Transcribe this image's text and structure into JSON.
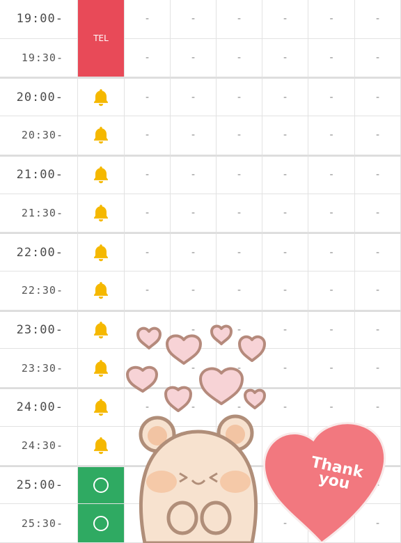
{
  "schedule": {
    "rows": [
      {
        "time": "19:00-",
        "status": "tel",
        "status_label": "TEL",
        "other_cells": [
          "-",
          "-",
          "-",
          "-",
          "-",
          "-"
        ]
      },
      {
        "time": "19:30-",
        "status": "tel",
        "status_label": "",
        "other_cells": [
          "-",
          "-",
          "-",
          "-",
          "-",
          "-"
        ]
      },
      {
        "time": "20:00-",
        "status": "bell",
        "status_label": "",
        "other_cells": [
          "-",
          "-",
          "-",
          "-",
          "-",
          "-"
        ]
      },
      {
        "time": "20:30-",
        "status": "bell",
        "status_label": "",
        "other_cells": [
          "-",
          "-",
          "-",
          "-",
          "-",
          "-"
        ]
      },
      {
        "time": "21:00-",
        "status": "bell",
        "status_label": "",
        "other_cells": [
          "-",
          "-",
          "-",
          "-",
          "-",
          "-"
        ]
      },
      {
        "time": "21:30-",
        "status": "bell",
        "status_label": "",
        "other_cells": [
          "-",
          "-",
          "-",
          "-",
          "-",
          "-"
        ]
      },
      {
        "time": "22:00-",
        "status": "bell",
        "status_label": "",
        "other_cells": [
          "-",
          "-",
          "-",
          "-",
          "-",
          "-"
        ]
      },
      {
        "time": "22:30-",
        "status": "bell",
        "status_label": "",
        "other_cells": [
          "-",
          "-",
          "-",
          "-",
          "-",
          "-"
        ]
      },
      {
        "time": "23:00-",
        "status": "bell",
        "status_label": "",
        "other_cells": [
          "-",
          "-",
          "-",
          "-",
          "-",
          "-"
        ]
      },
      {
        "time": "23:30-",
        "status": "bell",
        "status_label": "",
        "other_cells": [
          "-",
          "-",
          "-",
          "-",
          "-",
          "-"
        ]
      },
      {
        "time": "24:00-",
        "status": "bell",
        "status_label": "",
        "other_cells": [
          "-",
          "-",
          "-",
          "-",
          "-",
          "-"
        ]
      },
      {
        "time": "24:30-",
        "status": "bell",
        "status_label": "",
        "other_cells": [
          "-",
          "-",
          "-",
          "-",
          "-",
          "-"
        ]
      },
      {
        "time": "25:00-",
        "status": "available",
        "status_label": "",
        "other_cells": [
          "-",
          "-",
          "-",
          "-",
          "-",
          "-"
        ]
      },
      {
        "time": "25:30-",
        "status": "available",
        "status_label": "",
        "other_cells": [
          "-",
          "-",
          "-",
          "-",
          "-",
          "-"
        ]
      }
    ]
  },
  "sticker": {
    "text_line1": "Thank",
    "text_line2": "you",
    "big_heart_color": "#f2787f",
    "small_heart_color": "#f7d3d6",
    "bear_color": "#f7e2cf"
  },
  "colors": {
    "tel": "#e84a58",
    "available": "#2faa62",
    "bell": "#f5b800"
  }
}
